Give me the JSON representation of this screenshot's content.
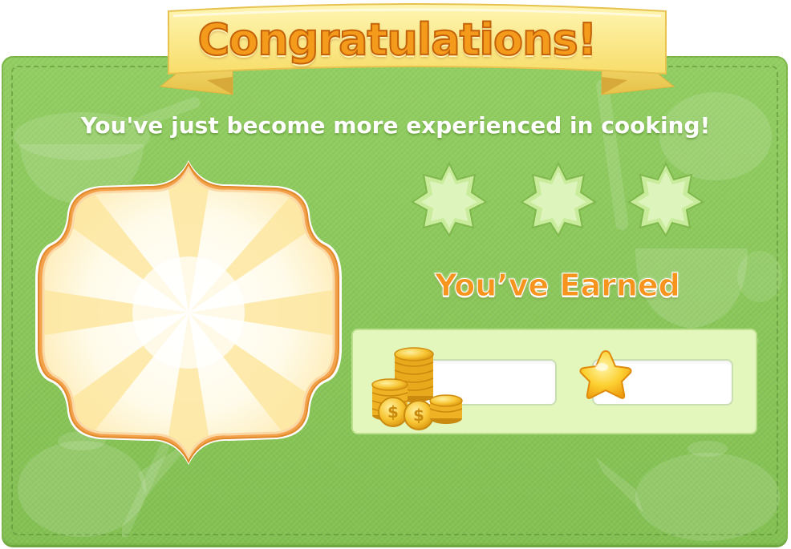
{
  "dialog": {
    "title": "Congratulations!",
    "subtitle": "You've just become more experienced in cooking!",
    "earned_label": "You’ve Earned"
  },
  "stars": {
    "total": 3,
    "filled": 0
  },
  "rewards": {
    "coins": {
      "icon": "coins-icon",
      "value": ""
    },
    "experience": {
      "icon": "star-icon",
      "value": ""
    }
  },
  "colors": {
    "card_green": "#8cc95c",
    "title_orange": "#f59b1c",
    "ribbon_yellow": "#fbe883",
    "frame_orange": "#f3a24b",
    "panel_bg": "#e3f7bd"
  }
}
